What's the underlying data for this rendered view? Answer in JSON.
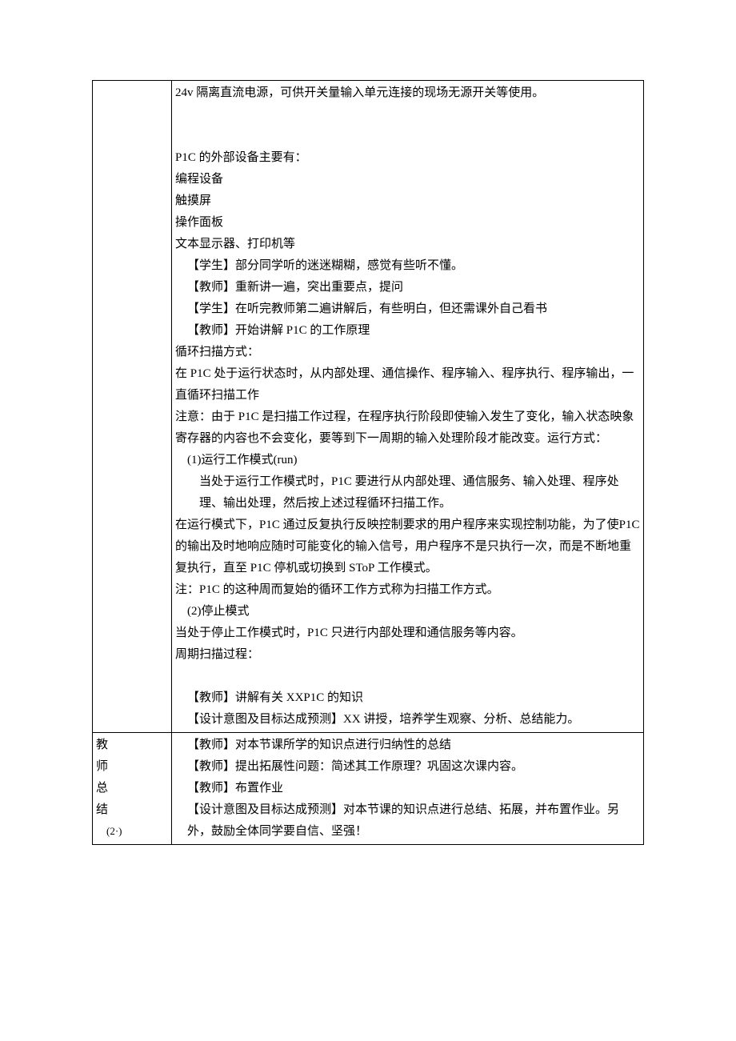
{
  "row1": {
    "left": "",
    "body": {
      "l1": "24v 隔离直流电源，可供开关量输入单元连接的现场无源开关等使用。",
      "l2": "P1C 的外部设备主要有：",
      "l3": "编程设备",
      "l4": "触摸屏",
      "l5": "操作面板",
      "l6": "文本显示器、打印机等",
      "l7": "【学生】部分同学听的迷迷糊糊，感觉有些听不懂。",
      "l8": "【教师】重新讲一遍，突出重要点，提问",
      "l9": "【学生】在听完教师第二遍讲解后，有些明白，但还需课外自己看书",
      "l10": "【教师】开始讲解 P1C 的工作原理",
      "l11": "循环扫描方式：",
      "l12": "在 P1C 处于运行状态时，从内部处理、通信操作、程序输入、程序执行、程序输出，一直循环扫描工作",
      "l13": "注意：由于 P1C 是扫描工作过程，在程序执行阶段即使输入发生了变化，输入状态映象寄存器的内容也不会变化，要等到下一周期的输入处理阶段才能改变。运行方式：",
      "l14": "(1)运行工作模式(run)",
      "l15": "当处于运行工作模式时，P1C 要进行从内部处理、通信服务、输入处理、程序处理、输出处理，然后按上述过程循环扫描工作。",
      "l16": "在运行模式下，P1C 通过反复执行反映控制要求的用户程序来实现控制功能，为了使P1C 的输出及时地响应随时可能变化的输入信号，用户程序不是只执行一次，而是不断地重复执行，直至 P1C 停机或切换到 SToP 工作模式。",
      "l17": "注：P1C 的这种周而复始的循环工作方式称为扫描工作方式。",
      "l18": "(2)停止模式",
      "l19": "当处于停止工作模式时，P1C 只进行内部处理和通信服务等内容。",
      "l20": "周期扫描过程：",
      "l21": "【教师】讲解有关 XXP1C 的知识",
      "l22": "【设计意图及目标达成预测】XX 讲授，培养学生观察、分析、总结能力。"
    }
  },
  "row2": {
    "left": {
      "c1": "教",
      "c2": "师",
      "c3": "总",
      "c4": "结",
      "note": "(2·)"
    },
    "body": {
      "l1": "【教师】对本节课所学的知识点进行归纳性的总结",
      "l2": "【教师】提出拓展性问题：简述其工作原理？巩固这次课内容。",
      "l3": "【教师】布置作业",
      "l4": "【设计意图及目标达成预测】对本节课的知识点进行总结、拓展，并布置作业。另外，鼓励全体同学要自信、坚强！"
    }
  }
}
